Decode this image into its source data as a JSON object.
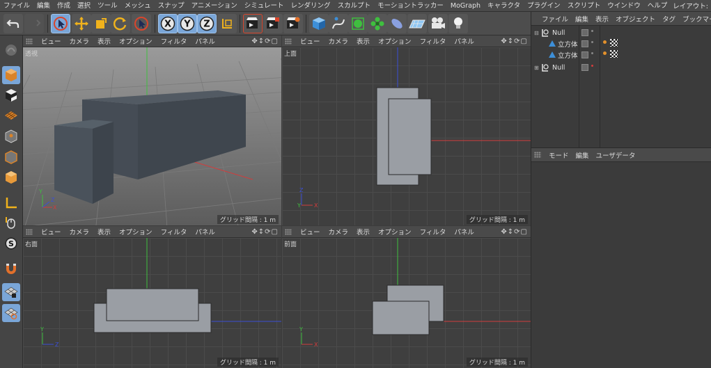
{
  "menu": [
    "ファイル",
    "編集",
    "作成",
    "選択",
    "ツール",
    "メッシュ",
    "スナップ",
    "アニメーション",
    "シミュレート",
    "レンダリング",
    "スカルプト",
    "モーショントラッカー",
    "MoGraph",
    "キャラクタ",
    "プラグイン",
    "スクリプト",
    "ウインドウ",
    "ヘルプ"
  ],
  "layout_label": "レイアウト:",
  "toolbar": {
    "x_axis": "X",
    "y_axis": "Y",
    "z_axis": "Z",
    "icons": [
      "undo-icon",
      "redo-icon",
      "live-select-icon",
      "move-icon",
      "scale-icon",
      "rotate-icon",
      "recent-tool-icon",
      "x-axis-icon",
      "y-axis-icon",
      "z-axis-icon",
      "coordinate-system-icon",
      "render-view-icon",
      "render-picture-viewer-icon",
      "render-settings-icon",
      "cube-icon",
      "spline-pen-icon",
      "subdivision-icon",
      "mograph-cloner-icon",
      "deformer-icon",
      "floor-icon",
      "camera-icon",
      "light-icon"
    ]
  },
  "viewport_menu": [
    "ビュー",
    "カメラ",
    "表示",
    "オプション",
    "フィルタ",
    "パネル"
  ],
  "viewports": [
    {
      "name": "透視",
      "grid": "グリッド間隔 : 1 m"
    },
    {
      "name": "上面",
      "grid": "グリッド間隔 : 1 m"
    },
    {
      "name": "右面",
      "grid": "グリッド間隔 : 1 m"
    },
    {
      "name": "前面",
      "grid": "グリッド間隔 : 1 m"
    }
  ],
  "axis_labels": {
    "x": "X",
    "y": "Y",
    "z": "Z"
  },
  "object_manager": {
    "menu": [
      "ファイル",
      "編集",
      "表示",
      "オブジェクト",
      "タグ",
      "ブックマー"
    ],
    "objects": [
      {
        "name": "Null",
        "level": 0,
        "type": "null"
      },
      {
        "name": "立方体",
        "level": 1,
        "type": "cube"
      },
      {
        "name": "立方体",
        "level": 1,
        "type": "cube"
      },
      {
        "name": "Null",
        "level": 0,
        "type": "null"
      }
    ]
  },
  "attribute_manager": {
    "menu": [
      "モード",
      "編集",
      "ユーザデータ"
    ]
  },
  "colors": {
    "x_axis": "#d23c3c",
    "y_axis": "#3fbf3f",
    "z_axis": "#3b4fd6",
    "selected_tool": "#7aa6d8",
    "object_fill": "#9a9ea4"
  }
}
